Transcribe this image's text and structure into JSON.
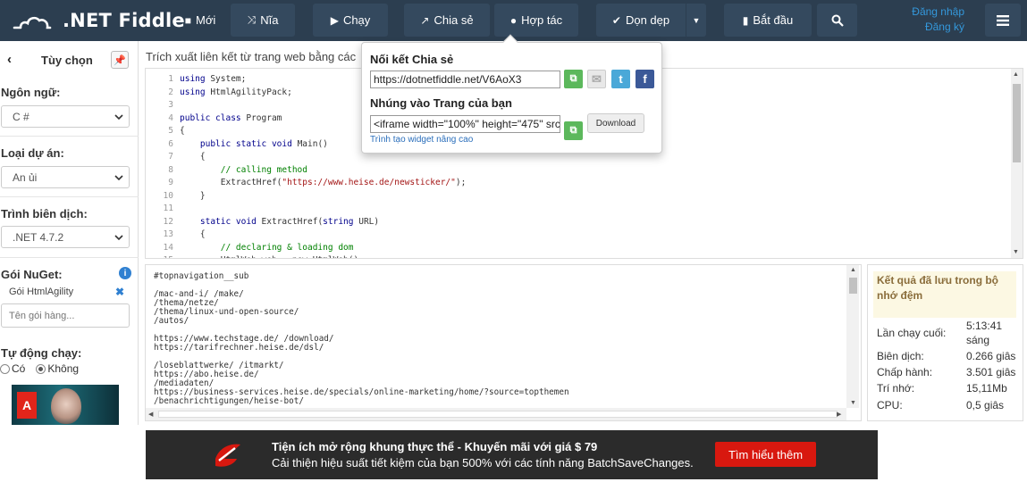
{
  "header": {
    "logo_text": ".NET Fiddle",
    "buttons": {
      "new": "Mới",
      "fork": "Nĩa",
      "run": "Chạy",
      "share": "Chia sẻ",
      "collaborate": "Hợp tác",
      "tidy": "Dọn dẹp",
      "getting_started": "Bắt đầu"
    },
    "login": "Đăng nhập",
    "register": "Đăng ký"
  },
  "sidebar": {
    "title": "Tùy chọn",
    "language_label": "Ngôn ngữ:",
    "language_value": "C #",
    "project_type_label": "Loại dự án:",
    "project_type_value": "An ủi",
    "compiler_label": "Trình biên dịch:",
    "compiler_value": ".NET 4.7.2",
    "nuget_label": "Gói NuGet:",
    "nuget_package": "Gói HtmlAgility",
    "nuget_placeholder": "Tên gói hàng...",
    "autorun_label": "Tự động chạy:",
    "autorun_yes": "Có",
    "autorun_no": "Không",
    "autorun_selected": "Không"
  },
  "description": "Trích xuất liên kết từ trang web bằng các",
  "editor": {
    "lines": [
      [
        {
          "t": "using",
          "c": "kw"
        },
        {
          "t": " System;"
        }
      ],
      [
        {
          "t": "using",
          "c": "kw"
        },
        {
          "t": " HtmlAgilityPack;"
        }
      ],
      [],
      [
        {
          "t": "public class",
          "c": "kw"
        },
        {
          "t": " Program"
        }
      ],
      [
        {
          "t": "{"
        }
      ],
      [
        {
          "t": "    "
        },
        {
          "t": "public static void",
          "c": "kw"
        },
        {
          "t": " Main()"
        }
      ],
      [
        {
          "t": "    {"
        }
      ],
      [
        {
          "t": "        "
        },
        {
          "t": "// calling method",
          "c": "cm"
        }
      ],
      [
        {
          "t": "        ExtractHref("
        },
        {
          "t": "\"https://www.heise.de/newsticker/\"",
          "c": "str"
        },
        {
          "t": ");"
        }
      ],
      [
        {
          "t": "    }"
        }
      ],
      [],
      [
        {
          "t": "    "
        },
        {
          "t": "static void",
          "c": "kw"
        },
        {
          "t": " ExtractHref("
        },
        {
          "t": "string",
          "c": "kw"
        },
        {
          "t": " URL)"
        }
      ],
      [
        {
          "t": "    {"
        }
      ],
      [
        {
          "t": "        "
        },
        {
          "t": "// declaring & loading dom",
          "c": "cm"
        }
      ],
      [
        {
          "t": "        HtmlWeb web = new HtmlWeb();"
        }
      ]
    ]
  },
  "output_lines": [
    "#topnavigation__sub",
    "",
    "/mac-and-i/ /make/",
    "/thema/netze/",
    "/thema/linux-und-open-source/",
    "/autos/",
    "",
    "https://www.techstage.de/ /download/",
    "https://tarifrechner.heise.de/dsl/",
    "",
    "/loseblattwerke/ /itmarkt/",
    "https://abo.heise.de/",
    "/mediadaten/",
    "https://business-services.heise.de/specials/online-marketing/home/?source=topthemen",
    "/benachrichtigungen/heise-bot/"
  ],
  "stats": {
    "cache_note": "Kết quả đã lưu trong bộ nhớ đệm",
    "last_run_label": "Lần chạy cuối:",
    "last_run_time": "5:13:41",
    "last_run_ampm": "sáng",
    "compile_label": "Biên dịch:",
    "compile_value": "0.266 giâs",
    "execute_label": "Chấp hành:",
    "execute_value": "3.501 giâs",
    "memory_label": "Trí nhớ:",
    "memory_value": "15,11Mb",
    "cpu_label": "CPU:",
    "cpu_value": "0,5 giâs"
  },
  "share_popup": {
    "share_link_title": "Nối kết Chia sẻ",
    "share_url": "https://dotnetfiddle.net/V6AoX3",
    "embed_title": "Nhúng vào Trang của bạn",
    "embed_code": "<iframe width=\"100%\" height=\"475\" src",
    "download": "Download",
    "widget_link": "Trình tạo widget nâng cao"
  },
  "banner": {
    "line1": "Tiện ích mở rộng khung thực thể - Khuyến mãi với giá $ 79",
    "line2": "Cải thiện hiệu suất tiết kiệm của bạn 500% với các tính năng BatchSaveChanges.",
    "cta": "Tìm hiểu thêm"
  },
  "ad": {
    "brand": "A"
  },
  "colors": {
    "topbar": "#2c3e50",
    "button": "#34495e",
    "link": "#3498db",
    "copy_button": "#5cb85c",
    "banner_cta": "#d8180f"
  }
}
